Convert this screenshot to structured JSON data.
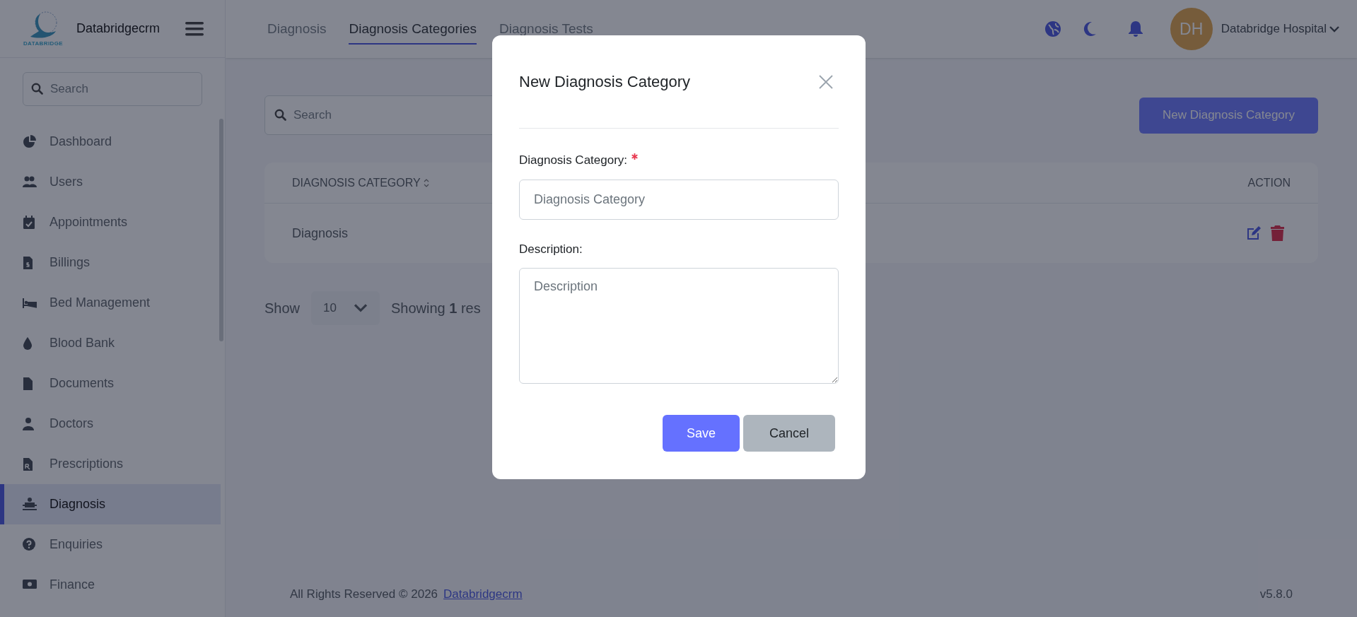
{
  "sidebar": {
    "brand": "Databridgecrm",
    "logo_text": "DATABRIDGE",
    "search": {
      "placeholder": "Search"
    },
    "items": [
      {
        "label": "Dashboard",
        "selected": false
      },
      {
        "label": "Users",
        "selected": false
      },
      {
        "label": "Appointments",
        "selected": false
      },
      {
        "label": "Billings",
        "selected": false
      },
      {
        "label": "Bed Management",
        "selected": false
      },
      {
        "label": "Blood Bank",
        "selected": false
      },
      {
        "label": "Documents",
        "selected": false
      },
      {
        "label": "Doctors",
        "selected": false
      },
      {
        "label": "Prescriptions",
        "selected": false
      },
      {
        "label": "Diagnosis",
        "selected": true
      },
      {
        "label": "Enquiries",
        "selected": false
      },
      {
        "label": "Finance",
        "selected": false
      }
    ]
  },
  "header": {
    "tabs": [
      {
        "label": "Diagnosis",
        "selected": false
      },
      {
        "label": "Diagnosis Categories",
        "selected": true
      },
      {
        "label": "Diagnosis Tests",
        "selected": false
      }
    ],
    "user": {
      "initials": "DH",
      "name": "Databridge Hospital"
    }
  },
  "content": {
    "search": {
      "placeholder": "Search"
    },
    "new_button": "New Diagnosis Category",
    "table": {
      "columns": [
        "DIAGNOSIS CATEGORY",
        "ACTION"
      ],
      "rows": [
        {
          "diagnosis_category": "Diagnosis"
        }
      ]
    },
    "pagination": {
      "show_label": "Show",
      "page_size": "10",
      "summary": "Showing **1** res"
    }
  },
  "footer": {
    "copyright": "All Rights Reserved © 2026",
    "link": "Databridgecrm",
    "version": "v5.8.0"
  },
  "modal": {
    "title": "New Diagnosis Category",
    "fields": [
      {
        "kind": "input",
        "label": "Diagnosis Category:",
        "required": true,
        "placeholder": "Diagnosis Category"
      },
      {
        "kind": "textarea",
        "label": "Description:",
        "required": false,
        "placeholder": "Description"
      }
    ],
    "save": "Save",
    "cancel": "Cancel"
  }
}
